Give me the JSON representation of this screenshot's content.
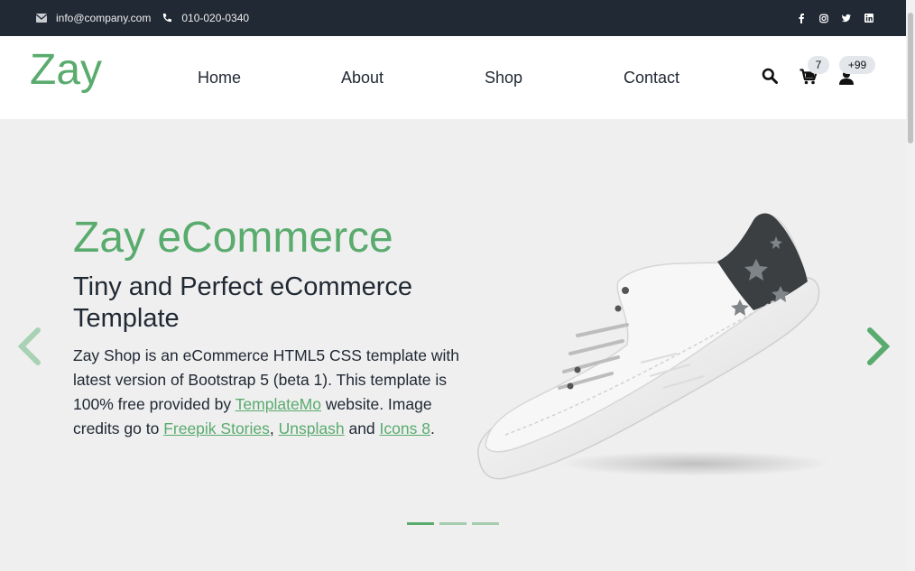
{
  "topbar": {
    "email": "info@company.com",
    "phone": "010-020-0340",
    "social": [
      "facebook-icon",
      "instagram-icon",
      "twitter-icon",
      "linkedin-icon"
    ]
  },
  "brand": {
    "logo": "Zay",
    "accent": "#59ab6e"
  },
  "nav": {
    "links": [
      "Home",
      "About",
      "Shop",
      "Contact"
    ],
    "cart_count": "7",
    "user_count": "+99"
  },
  "hero": {
    "title": "Zay eCommerce",
    "subtitle": "Tiny and Perfect eCommerce Template",
    "text_before": "Zay Shop is an eCommerce HTML5 CSS template with latest version of Bootstrap 5 (beta 1). This template is 100% free provided by ",
    "link1": "TemplateMo",
    "text_mid1": " website. Image credits go to ",
    "link2": "Freepik Stories",
    "text_mid2": ", ",
    "link3": "Unsplash",
    "text_mid3": " and ",
    "link4": "Icons 8",
    "text_end": "."
  },
  "carousel": {
    "slides": 3,
    "active": 0
  },
  "colors": {
    "topbar": "#212934",
    "accent": "#59ab6e",
    "hero_bg": "#efefef"
  }
}
